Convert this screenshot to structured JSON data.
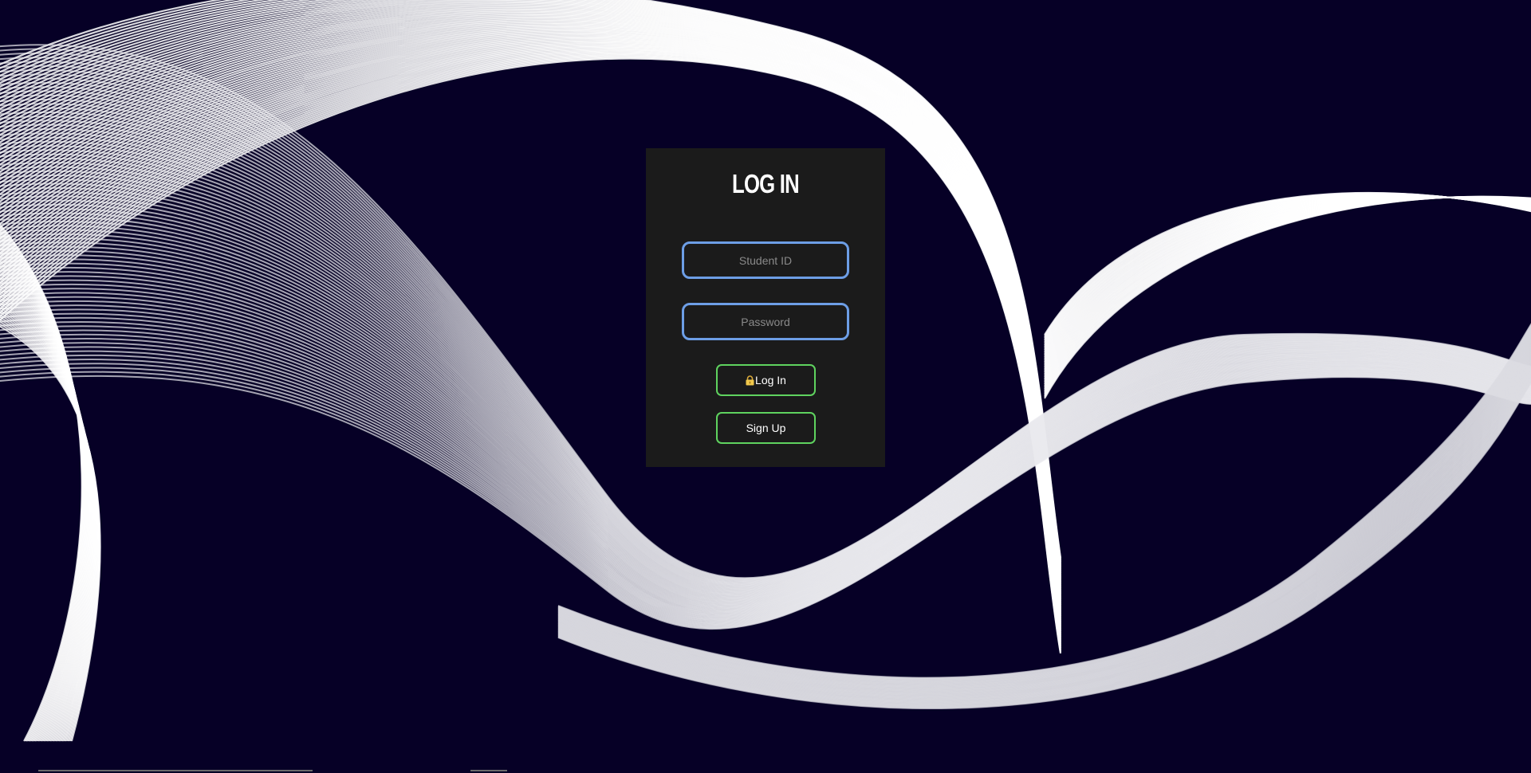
{
  "login": {
    "title": "LOG IN",
    "student_id_placeholder": "Student ID",
    "password_placeholder": "Password",
    "login_button_label": "Log In",
    "signup_button_label": "Sign Up"
  },
  "icons": {
    "login_button_icon": "lock-icon"
  },
  "colors": {
    "background": "#060026",
    "panel": "#1b1b1b",
    "input_border": "#6d9ee6",
    "button_border": "#5fd35f",
    "lock_icon": "#f2c94c"
  }
}
